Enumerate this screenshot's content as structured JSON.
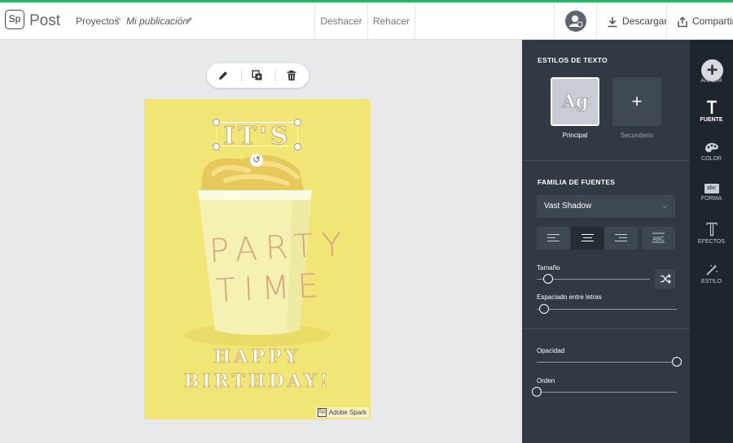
{
  "app": {
    "logo_text": "Sp",
    "name": "Post"
  },
  "breadcrumb": {
    "root": "Proyectos",
    "separator": ">",
    "current": "Mi publicación"
  },
  "toolbar": {
    "undo": "Deshacer",
    "redo": "Rehacer",
    "download": "Descargar",
    "share": "Compartir"
  },
  "card": {
    "title": "IT'S",
    "cup_line1": "PARTY",
    "cup_line2": "TIME",
    "footer_line1": "HAPPY",
    "footer_line2": "BIRTHDAY!",
    "watermark_logo": "Sp",
    "watermark": "Adobe Spark"
  },
  "panel": {
    "text_styles_heading": "ESTILOS DE TEXTO",
    "primary_sample": "Ag",
    "primary_label": "Principal",
    "secondary_icon": "+",
    "secondary_label": "Secundario",
    "font_family_heading": "FAMILIA DE FUENTES",
    "font_value": "Vast Shadow",
    "size_label": "Tamaño",
    "size_value": 0.1,
    "spacing_label": "Espaciado entre letras",
    "spacing_value": 0.05,
    "opacity_label": "Opacidad",
    "opacity_value": 1.0,
    "order_label": "Orden",
    "order_value": 0.0,
    "active_alignment": "center"
  },
  "rail": {
    "items": [
      {
        "label": "AÑADIR",
        "icon": "plus-icon"
      },
      {
        "label": "FUENTE",
        "icon": "font-icon",
        "active": true
      },
      {
        "label": "COLOR",
        "icon": "palette-icon"
      },
      {
        "label": "FORMA",
        "icon": "shape-icon",
        "badge": "abc"
      },
      {
        "label": "EFECTOS",
        "icon": "effects-icon"
      },
      {
        "label": "ESTILO",
        "icon": "magic-wand-icon"
      }
    ]
  },
  "colors": {
    "accent_bar": "#2fb36a",
    "panel_bg": "#303944",
    "rail_bg": "#1f252c",
    "card_bg": "#f1e576"
  }
}
